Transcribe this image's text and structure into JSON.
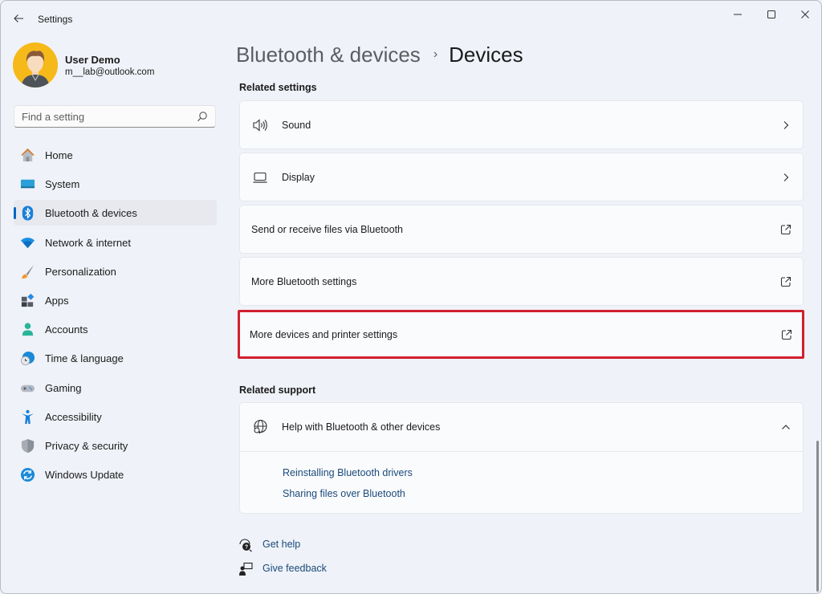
{
  "window": {
    "app_title": "Settings",
    "controls": {
      "minimize": "minimize",
      "maximize": "maximize",
      "close": "close"
    }
  },
  "profile": {
    "name": "User Demo",
    "email": "m__lab@outlook.com"
  },
  "search": {
    "placeholder": "Find a setting",
    "value": ""
  },
  "sidebar": {
    "items": [
      {
        "label": "Home",
        "icon": "home-icon",
        "active": false
      },
      {
        "label": "System",
        "icon": "system-icon",
        "active": false
      },
      {
        "label": "Bluetooth & devices",
        "icon": "bluetooth-icon",
        "active": true
      },
      {
        "label": "Network & internet",
        "icon": "wifi-icon",
        "active": false
      },
      {
        "label": "Personalization",
        "icon": "brush-icon",
        "active": false
      },
      {
        "label": "Apps",
        "icon": "apps-icon",
        "active": false
      },
      {
        "label": "Accounts",
        "icon": "accounts-icon",
        "active": false
      },
      {
        "label": "Time & language",
        "icon": "time-language-icon",
        "active": false
      },
      {
        "label": "Gaming",
        "icon": "gamepad-icon",
        "active": false
      },
      {
        "label": "Accessibility",
        "icon": "accessibility-icon",
        "active": false
      },
      {
        "label": "Privacy & security",
        "icon": "shield-icon",
        "active": false
      },
      {
        "label": "Windows Update",
        "icon": "windows-update-icon",
        "active": false
      }
    ]
  },
  "breadcrumb": {
    "parent": "Bluetooth & devices",
    "separator": "›",
    "current": "Devices"
  },
  "related_settings": {
    "title": "Related settings",
    "items": [
      {
        "label": "Sound",
        "icon": "speaker-icon",
        "trail": "chevron-right-icon"
      },
      {
        "label": "Display",
        "icon": "laptop-icon",
        "trail": "chevron-right-icon"
      },
      {
        "label": "Send or receive files via Bluetooth",
        "icon": null,
        "trail": "external-link-icon"
      },
      {
        "label": "More Bluetooth settings",
        "icon": null,
        "trail": "external-link-icon"
      },
      {
        "label": "More devices and printer settings",
        "icon": null,
        "trail": "external-link-icon",
        "highlighted": true
      }
    ]
  },
  "related_support": {
    "title": "Related support",
    "header": {
      "label": "Help with Bluetooth & other devices",
      "icon": "globe-search-icon",
      "expanded": true
    },
    "links": [
      "Reinstalling Bluetooth drivers",
      "Sharing files over Bluetooth"
    ]
  },
  "footer": {
    "get_help": "Get help",
    "give_feedback": "Give feedback"
  },
  "colors": {
    "accent": "#0067c0",
    "highlight_border": "#d1202f",
    "link": "#1a4a7a"
  }
}
